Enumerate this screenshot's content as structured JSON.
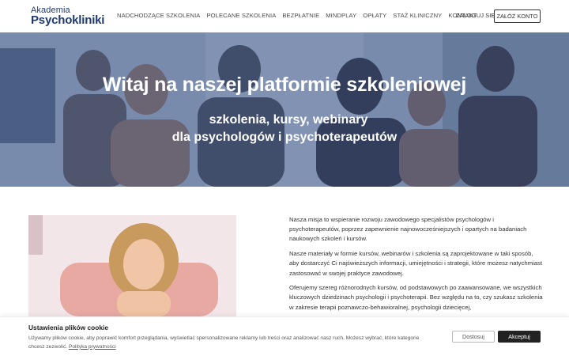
{
  "logo": {
    "line1": "Akademia",
    "line2": "Psychokliniki"
  },
  "nav": [
    "NADCHODZĄCE SZKOLENIA",
    "POLECANE SZKOLENIA",
    "BEZPŁATNIE",
    "MINDPLAY",
    "OPŁATY",
    "STAŻ KLINICZNY",
    "KONTAKT"
  ],
  "auth": {
    "login": "ZALOGUJ SIĘ",
    "register": "ZAŁÓŻ KONTO"
  },
  "hero": {
    "title": "Witaj na naszej platformie szkoleniowej",
    "subtitle1": "szkolenia, kursy, webinary",
    "subtitle2": "dla psychologów i psychoterapeutów"
  },
  "content": {
    "paragraphs": [
      "Nasza misja to wspieranie rozwoju zawodowego specjalistów psychologów i psychoterapeutów, poprzez zapewnienie najnowocześniejszych i opartych na badaniach naukowych szkoleń i kursów.",
      "Nasze materiały w formie kursów, webinarów i szkolenia są zaprojektowane w taki sposób, aby dostarczyć Ci najświeższych informacji, umiejętności i strategii, które możesz natychmiast zastosować w swojej praktyce zawodowej.",
      "Oferujemy szereg różnorodnych kursów, od podstawowych po zaawansowane, we wszystkich kluczowych dziedzinach psychologii i psychoterapii. Bez względu na to, czy szukasz szkolenia w zakresie terapii poznawczo-behawioralnej, psychologii dziecięcej,"
    ]
  },
  "cookie": {
    "title": "Ustawienia plików cookie",
    "text": "Używamy plików cookie, aby poprawić komfort przeglądania, wyświetlać spersonalizowane reklamy lub treści oraz analizować nasz ruch. Możesz wybrać, które kategorie chcesz zezwolić.",
    "link": "Polityka prywatności",
    "reject": "Dostosuj",
    "accept": "Akceptuj"
  }
}
